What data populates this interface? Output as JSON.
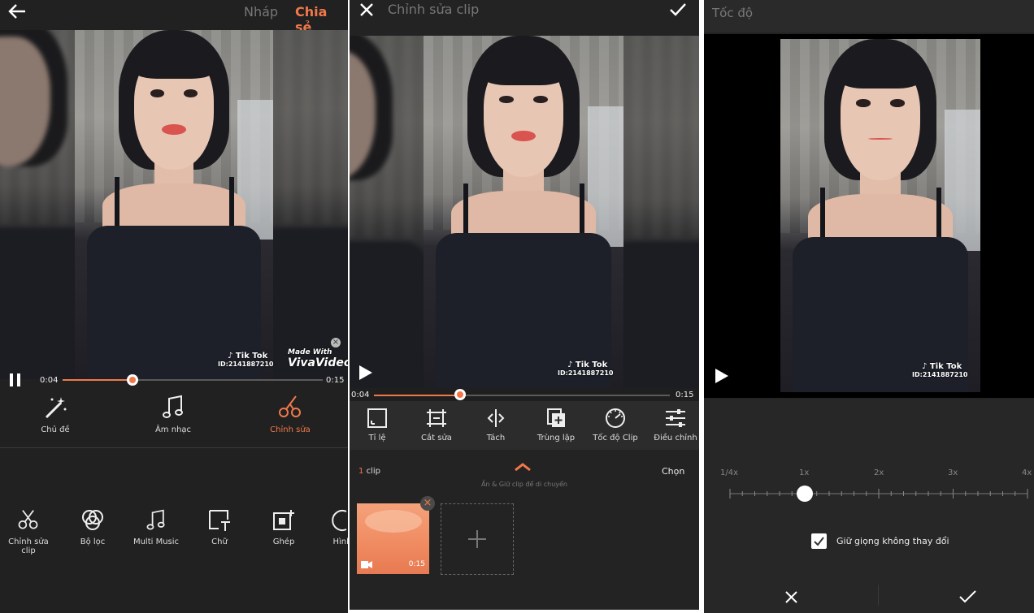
{
  "panel1": {
    "header": {
      "draft_label": "Nháp",
      "share_label": "Chia sẻ"
    },
    "video": {
      "tiktok_label": "Tik Tok",
      "tiktok_id": "ID:2141887210",
      "made_with": "Made With",
      "vivavideo": "VivaVideo"
    },
    "player": {
      "current_time": "0:04",
      "total_time": "0:15",
      "progress": 0.27
    },
    "main_tabs": [
      {
        "label": "Chủ đề",
        "icon": "magic-wand-icon"
      },
      {
        "label": "Âm nhạc",
        "icon": "music-note-icon"
      },
      {
        "label": "Chỉnh sửa",
        "icon": "scissors-icon",
        "active": true
      }
    ],
    "sub_tools": [
      {
        "label": "Chỉnh sửa clip",
        "icon": "scissors-icon"
      },
      {
        "label": "Bộ lọc",
        "icon": "filter-icon"
      },
      {
        "label": "Multi Music",
        "icon": "music-note-icon"
      },
      {
        "label": "Chữ",
        "icon": "text-icon"
      },
      {
        "label": "Ghép",
        "icon": "overlay-add-icon"
      },
      {
        "label": "Hình",
        "icon": "sticker-icon"
      }
    ]
  },
  "panel2": {
    "header": {
      "title": "Chỉnh sửa clip"
    },
    "video": {
      "tiktok_label": "Tik Tok",
      "tiktok_id": "ID:2141887210"
    },
    "player": {
      "current_time": "0:04",
      "total_time": "0:15",
      "progress": 0.29
    },
    "tools": [
      {
        "label": "Tỉ lệ",
        "icon": "aspect-ratio-icon"
      },
      {
        "label": "Cắt sửa",
        "icon": "trim-icon"
      },
      {
        "label": "Tách",
        "icon": "split-icon"
      },
      {
        "label": "Trùng lặp",
        "icon": "duplicate-icon"
      },
      {
        "label": "Tốc độ Clip",
        "icon": "speed-gauge-icon"
      },
      {
        "label": "Điều chỉnh",
        "icon": "sliders-icon"
      }
    ],
    "clips": {
      "count_number": "1",
      "count_label": "clip",
      "select_label": "Chọn",
      "hint": "Ấn & Giữ clip để di chuyển",
      "clip_duration": "0:15"
    }
  },
  "panel3": {
    "header": {
      "title": "Tốc độ"
    },
    "video": {
      "tiktok_label": "Tik Tok",
      "tiktok_id": "ID:2141887210"
    },
    "speed": {
      "ticks": [
        "1/4x",
        "1x",
        "2x",
        "3x",
        "4x"
      ],
      "value_label": "1x"
    },
    "keep_pitch": {
      "label": "Giữ giọng không thay đổi",
      "checked": true
    }
  },
  "colors": {
    "accent": "#f2784b",
    "background": "#212121"
  }
}
